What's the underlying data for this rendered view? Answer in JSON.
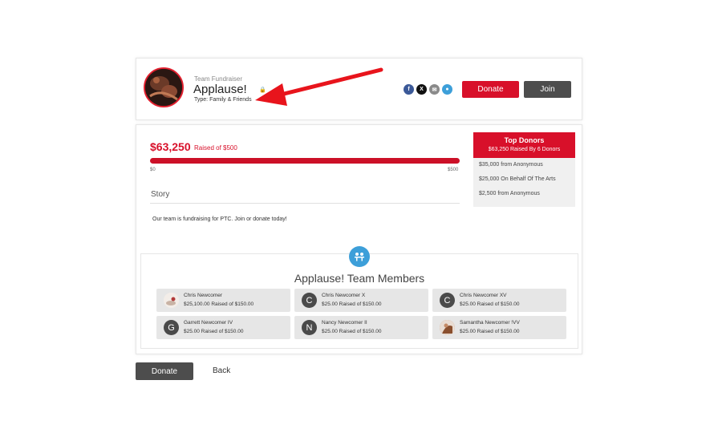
{
  "header": {
    "team_type": "Team Fundraiser",
    "team_name": "Applause!",
    "subtitle": "Type: Family & Friends",
    "social_icons": [
      "facebook-icon",
      "x-icon",
      "email-icon",
      "chat-icon"
    ],
    "donate_label": "Donate",
    "join_label": "Join"
  },
  "progress": {
    "amount": "$63,250",
    "raised_text": "Raised of $500",
    "min_label": "$0",
    "max_label": "$500",
    "fill_percent": 100
  },
  "story": {
    "title": "Story",
    "text": "Our team is fundraising for PTC. Join or donate today!"
  },
  "top_donors": {
    "title": "Top Donors",
    "subtitle": "$63,250 Raised By 6 Donors",
    "items": [
      "$35,000 from Anonymous",
      "$25,000 On Behalf Of The Arts",
      "$2,500 from Anonymous"
    ]
  },
  "members": {
    "title": "Applause! Team Members",
    "items": [
      {
        "name": "Chris Newcomer",
        "amount": "$25,100.00 Raised of $150.00",
        "initial": ""
      },
      {
        "name": "Chris Newcomer X",
        "amount": "$25.00 Raised of $150.00",
        "initial": "C"
      },
      {
        "name": "Chris Newcomer XV",
        "amount": "$25.00 Raised of $150.00",
        "initial": "C"
      },
      {
        "name": "Garrett Newcomer IV",
        "amount": "$25.00 Raised of $150.00",
        "initial": "G"
      },
      {
        "name": "Nancy Newcomer II",
        "amount": "$25.00 Raised of $150.00",
        "initial": "N"
      },
      {
        "name": "Samantha Newcomer !VV",
        "amount": "$25.00 Raised of $150.00",
        "initial": ""
      }
    ]
  },
  "footer": {
    "donate_label": "Donate",
    "back_label": "Back"
  },
  "colors": {
    "brand_red": "#d8102a",
    "dark_button": "#4d4d4d",
    "team_icon_blue": "#3d9fd9",
    "facebook": "#3b5998",
    "x": "#111111",
    "email": "#8a8a8a",
    "chat": "#3d9fd9"
  }
}
